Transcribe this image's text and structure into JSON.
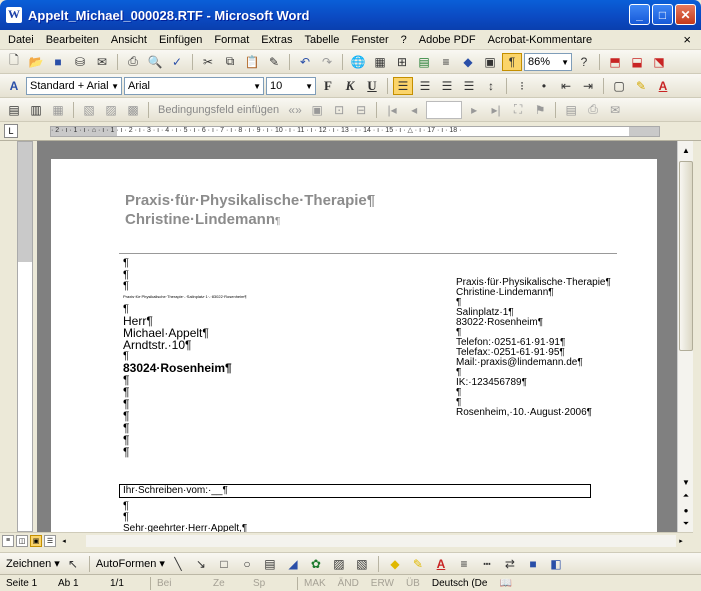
{
  "window": {
    "title": "Appelt_Michael_000028.RTF - Microsoft Word",
    "buttons": [
      "_",
      "□",
      "✕"
    ]
  },
  "menu": {
    "items": [
      "Datei",
      "Bearbeiten",
      "Ansicht",
      "Einfügen",
      "Format",
      "Extras",
      "Tabelle",
      "Fenster",
      "?",
      "Adobe PDF",
      "Acrobat-Kommentare"
    ],
    "close": "×"
  },
  "toolbar_standard": {
    "zoom": "86%"
  },
  "toolbar_format": {
    "style": "Standard + Arial",
    "font": "Arial",
    "size": "10",
    "bold": "F",
    "italic": "K",
    "underline": "U"
  },
  "toolbar_mailmerge": {
    "insert_field": "Bedingungsfeld einfügen"
  },
  "ruler": {
    "ticks": "· 2 · ı · 1 · ı · ⌂ · ı · 1 · ı · 2 · ı · 3 · ı · 4 · ı · 5 · ı · 6 · ı · 7 · ı · 8 · ı · 9 · ı · 10 · ı · 11 · ı · 12 · ı · 13 · ı · 14 · ı · 15 · ı · △ · ı · 17 · ı · 18 ·"
  },
  "document": {
    "header_line1": "Praxis·für·Physikalische·Therapie¶",
    "header_line2": "Christine·Lindemann",
    "header_line2_mark": "¶",
    "left_column": {
      "blank1": "¶",
      "blank2": "¶",
      "blank3": "¶",
      "sender_line": "Praxis·für·Physikalische·Therapie·-·Salinplatz·1·-·83022·Rosenheim¶",
      "blank4": "¶",
      "salutation": "Herr¶",
      "name": "Michael·Appelt¶",
      "street": "Arndtstr.·10¶",
      "blank5": "¶",
      "city": "83024·Rosenheim¶",
      "blank6": "¶",
      "blank7": "¶",
      "blank8": "¶",
      "blank9": "¶",
      "blank10": "¶",
      "blank11": "¶",
      "blank12": "¶"
    },
    "right_column": {
      "line1": "Praxis·für·Physikalische·Therapie¶",
      "line2": "Christine·Lindemann¶",
      "line3": "¶",
      "line4": "Salinplatz·1¶",
      "line5": "83022·Rosenheim¶",
      "line6": "¶",
      "line7": "Telefon:·0251-61·91·91¶",
      "line8": "Telefax:·0251-61·91·95¶",
      "line9": "Mail:·praxis@lindemann.de¶",
      "line10": "¶",
      "line11": "IK:·123456789¶",
      "line12": "¶",
      "line13": "¶",
      "line14": "Rosenheim,·10.·August·2006¶"
    },
    "subject": "Ihr·Schreiben·vom:·__¶",
    "after_subject1": "¶",
    "after_subject2": "¶",
    "greeting": "Sehr·geehrter·Herr·Appelt,¶"
  },
  "drawbar": {
    "draw": "Zeichnen ▾",
    "autoshapes": "AutoFormen ▾"
  },
  "status": {
    "page": "Seite 1",
    "section": "Ab 1",
    "pages": "1/1",
    "at": "Bei",
    "line": "Ze",
    "col": "Sp",
    "mak": "MAK",
    "and": "ÄND",
    "erw": "ERW",
    "ub": "ÜB",
    "lang": "Deutsch (De"
  }
}
